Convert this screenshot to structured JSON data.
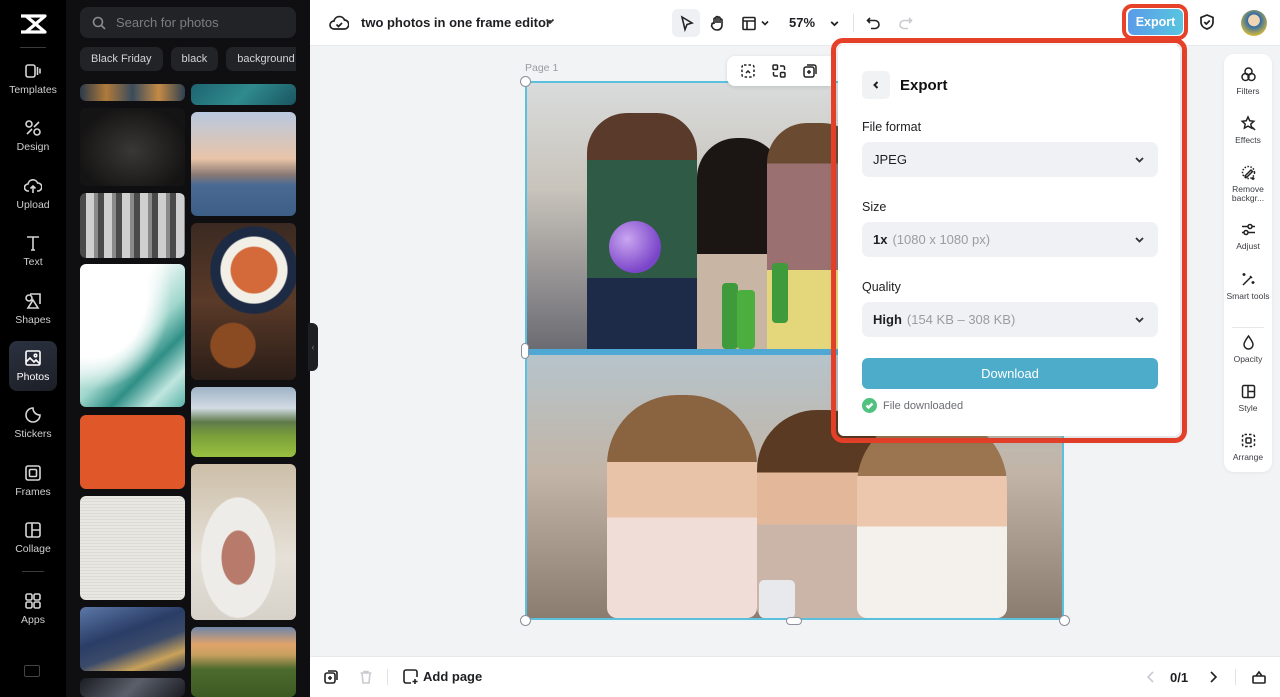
{
  "rail": {
    "items": [
      {
        "label": "Templates",
        "icon": "templates-icon"
      },
      {
        "label": "Design",
        "icon": "design-icon"
      },
      {
        "label": "Upload",
        "icon": "upload-icon"
      },
      {
        "label": "Text",
        "icon": "text-icon"
      },
      {
        "label": "Shapes",
        "icon": "shapes-icon"
      },
      {
        "label": "Photos",
        "icon": "photos-icon",
        "active": true
      },
      {
        "label": "Stickers",
        "icon": "stickers-icon"
      },
      {
        "label": "Frames",
        "icon": "frames-icon"
      },
      {
        "label": "Collage",
        "icon": "collage-icon"
      },
      {
        "label": "Apps",
        "icon": "apps-icon"
      }
    ]
  },
  "photos_panel": {
    "search_placeholder": "Search for photos",
    "chips": [
      "Black Friday",
      "black",
      "background"
    ],
    "thumbnails": [
      "aerial city night",
      "teal water",
      "dark wood texture",
      "city skyline by water",
      "stone pillars",
      "ramen and fried chicken meal",
      "teal abstract waves",
      "green countryside",
      "orange texture",
      "white paper texture",
      "plated meat and mushrooms",
      "city at dusk aerial",
      "bridge at sunset",
      "dark fabric"
    ]
  },
  "topbar": {
    "title": "two photos in one frame editor",
    "zoom": "57%",
    "export_label": "Export"
  },
  "canvas": {
    "page_label": "Page 1",
    "photos": [
      "friends party with balloon",
      "women with champagne and phone"
    ]
  },
  "export_panel": {
    "title": "Export",
    "file_format_label": "File format",
    "file_format_value": "JPEG",
    "size_label": "Size",
    "size_value": "1x",
    "size_detail": "(1080 x 1080 px)",
    "quality_label": "Quality",
    "quality_value": "High",
    "quality_detail": "(154 KB – 308 KB)",
    "download_label": "Download",
    "status_text": "File downloaded",
    "accent_color": "#4eaccb",
    "success_color": "#4fc27f"
  },
  "right_tools": {
    "items": [
      {
        "label": "Filters"
      },
      {
        "label": "Effects"
      },
      {
        "label": "Remove backgr..."
      },
      {
        "label": "Adjust"
      },
      {
        "label": "Smart tools"
      },
      {
        "label": "Opacity"
      },
      {
        "label": "Style"
      },
      {
        "label": "Arrange"
      }
    ]
  },
  "bottombar": {
    "add_page_label": "Add page",
    "page_indicator": "0/1"
  }
}
